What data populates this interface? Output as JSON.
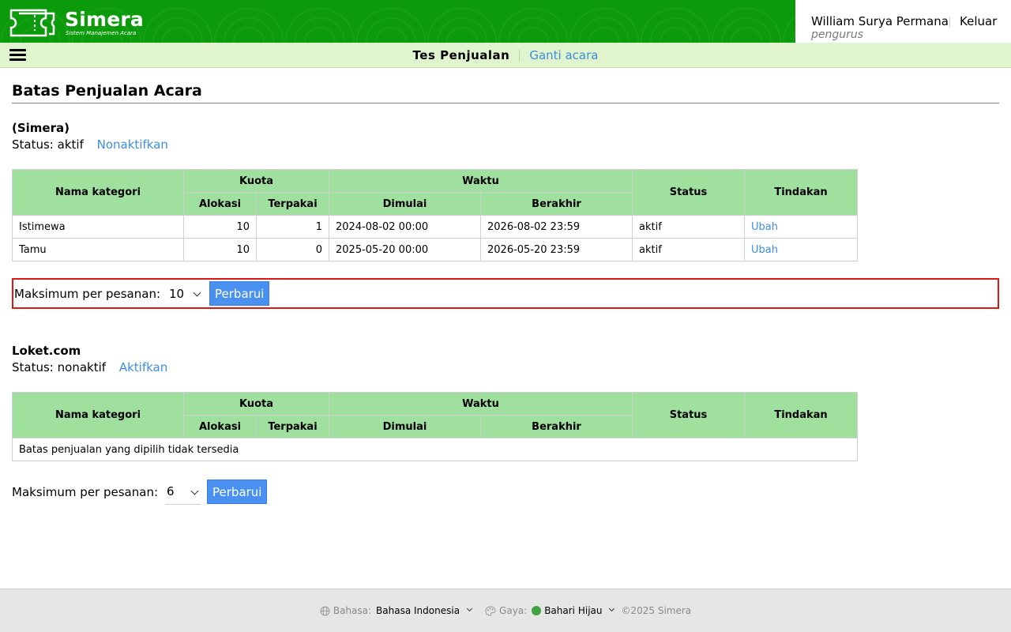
{
  "app": {
    "name": "Simera",
    "tagline": "Sistem Manajemen Acara",
    "colors": {
      "brand": "#0a9a0a",
      "accent": "#4a90f0",
      "table_header": "#9fe09f",
      "highlight": "#e01515"
    }
  },
  "user": {
    "name": "William Surya Permana",
    "role": "pengurus",
    "logout_label": "Keluar"
  },
  "subbar": {
    "event_name": "Tes Penjualan",
    "change_event_label": "Ganti acara"
  },
  "page": {
    "title": "Batas Penjualan Acara"
  },
  "table_headers": {
    "category": "Nama kategori",
    "quota": "Kuota",
    "allocation": "Alokasi",
    "used": "Terpakai",
    "time": "Waktu",
    "start": "Dimulai",
    "end": "Berakhir",
    "status": "Status",
    "action": "Tindakan"
  },
  "sections": [
    {
      "name": "(Simera)",
      "status_label": "Status:",
      "status_value": "aktif",
      "toggle_label": "Nonaktifkan",
      "rows": [
        {
          "category": "Istimewa",
          "allocation": "10",
          "used": "1",
          "start": "2024-08-02 00:00",
          "end": "2026-08-02 23:59",
          "status": "aktif",
          "action": "Ubah"
        },
        {
          "category": "Tamu",
          "allocation": "10",
          "used": "0",
          "start": "2025-05-20 00:00",
          "end": "2026-05-20 23:59",
          "status": "aktif",
          "action": "Ubah"
        }
      ],
      "max_label": "Maksimum per pesanan:",
      "max_value": "10",
      "update_label": "Perbarui"
    },
    {
      "name": "Loket.com",
      "status_label": "Status:",
      "status_value": "nonaktif",
      "toggle_label": "Aktifkan",
      "empty_message": "Batas penjualan yang dipilih tidak tersedia",
      "max_label": "Maksimum per pesanan:",
      "max_value": "6",
      "update_label": "Perbarui"
    }
  ],
  "footer": {
    "language_label": "Bahasa:",
    "language_value": "Bahasa Indonesia",
    "style_label": "Gaya:",
    "style_value": "Bahari Hijau",
    "copyright": "©2025 Simera",
    "icons": [
      "globe-icon",
      "palette-icon",
      "chevron-down-icon"
    ]
  }
}
